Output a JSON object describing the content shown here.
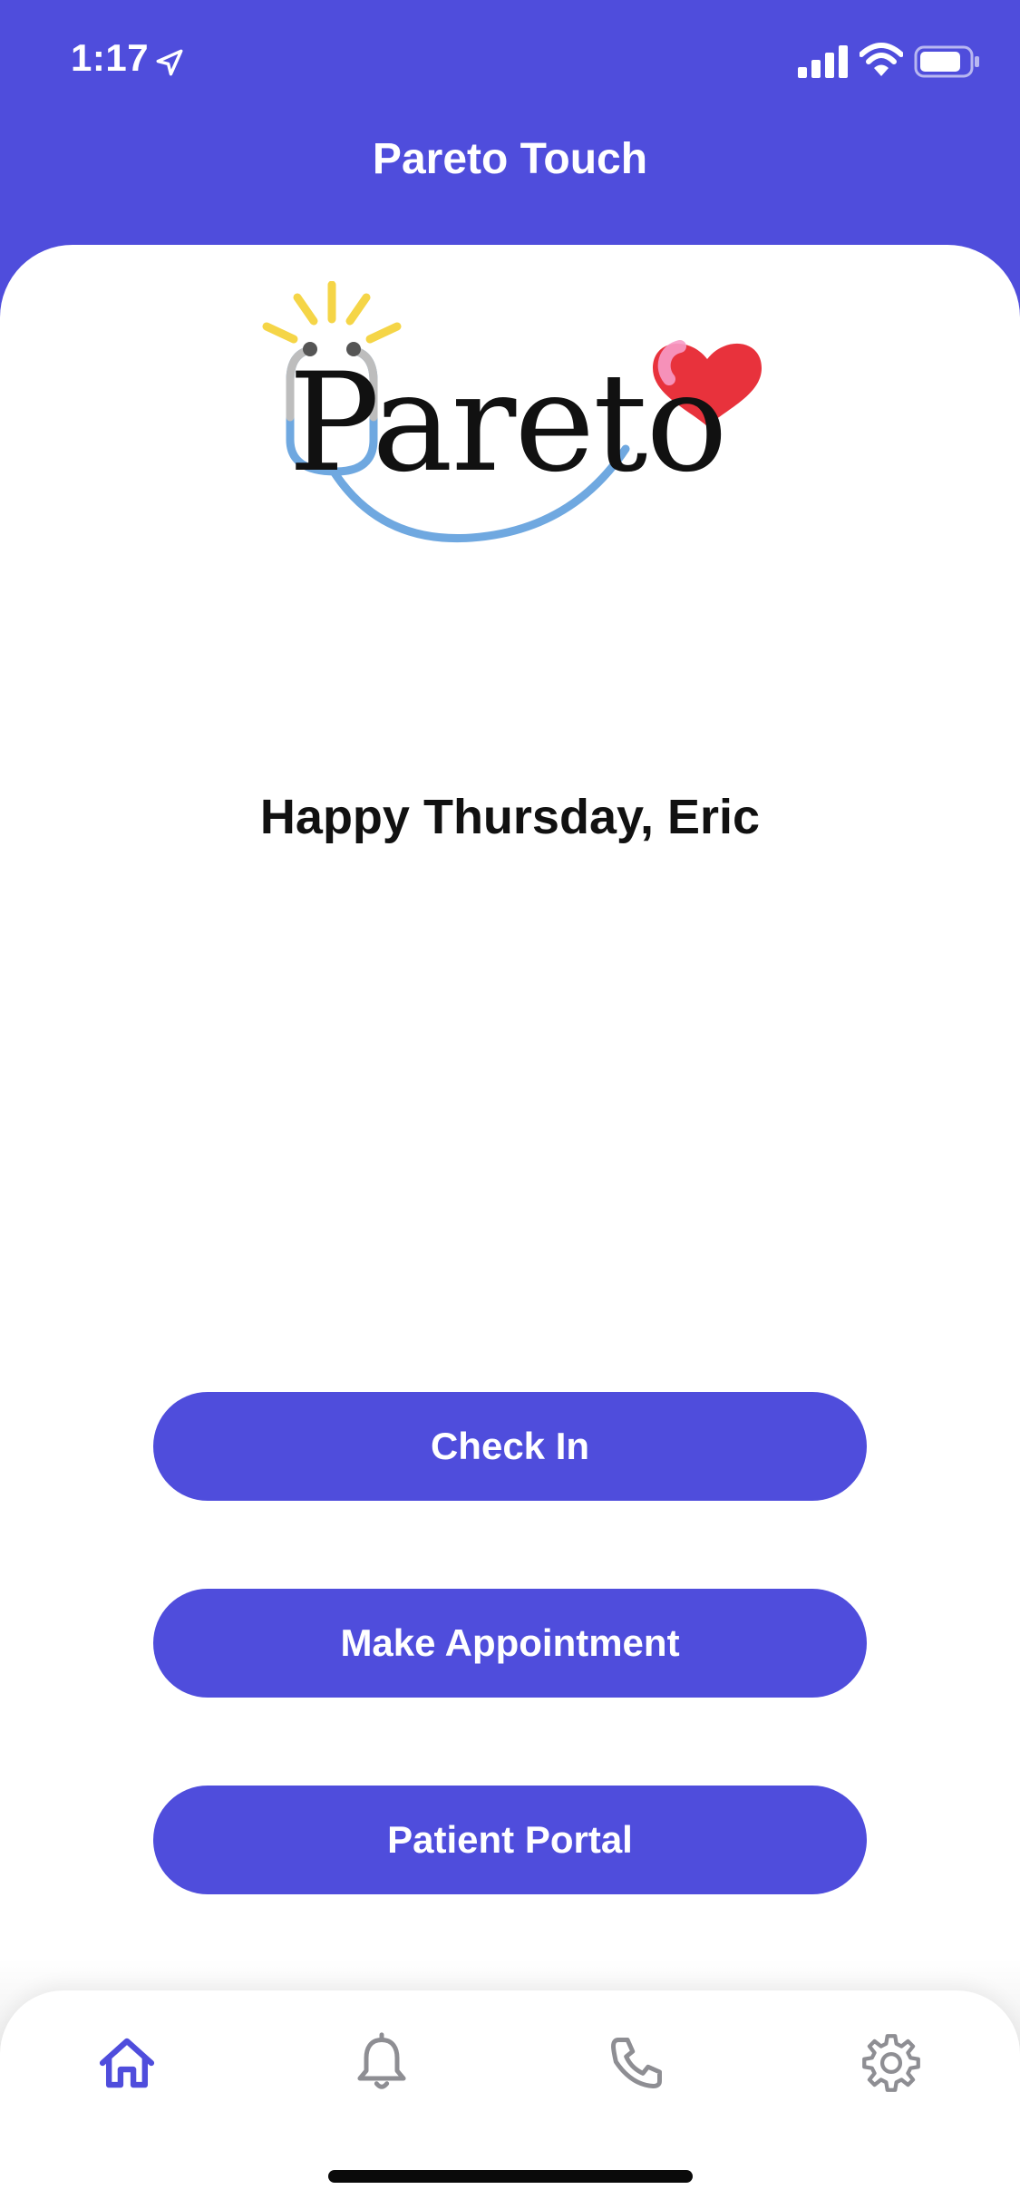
{
  "status_bar": {
    "time": "1:17",
    "icons": [
      "location-arrow-icon",
      "cellular-signal-icon",
      "wifi-icon",
      "battery-icon"
    ]
  },
  "header": {
    "title": "Pareto Touch"
  },
  "logo": {
    "wordmark": "Pareto",
    "icon": "stethoscope-heart-logo"
  },
  "main": {
    "greeting": "Happy Thursday, Eric",
    "buttons": [
      {
        "label": "Check In"
      },
      {
        "label": "Make Appointment"
      },
      {
        "label": "Patient Portal"
      }
    ]
  },
  "tab_bar": {
    "items": [
      {
        "icon": "home-icon",
        "active": true
      },
      {
        "icon": "bell-icon",
        "active": false
      },
      {
        "icon": "phone-icon",
        "active": false
      },
      {
        "icon": "gear-icon",
        "active": false
      }
    ]
  },
  "colors": {
    "accent": "#4F4DDC",
    "inactive_icon": "#8E8E93",
    "logo_yellow": "#F5D547",
    "logo_blue": "#6FA8E0",
    "logo_red": "#E8323C"
  }
}
